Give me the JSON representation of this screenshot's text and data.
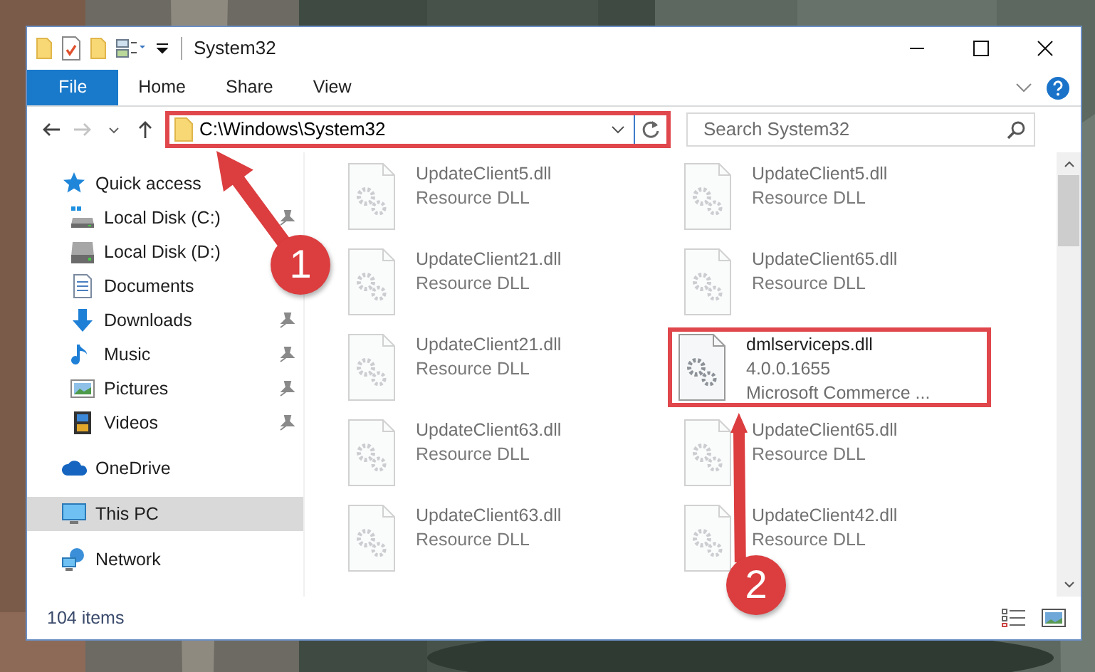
{
  "window": {
    "title": "System32"
  },
  "ribbon_tabs": [
    {
      "label": "File",
      "selected": true
    },
    {
      "label": "Home",
      "selected": false
    },
    {
      "label": "Share",
      "selected": false
    },
    {
      "label": "View",
      "selected": false
    }
  ],
  "address": {
    "value": "C:\\Windows\\System32",
    "highlighted": true
  },
  "search": {
    "placeholder": "Search System32"
  },
  "sidebar": {
    "items": [
      {
        "label": "Quick access",
        "kind": "star",
        "selected": false,
        "children": [
          {
            "label": "Local Disk (C:)",
            "kind": "drive-c",
            "pinned": true
          },
          {
            "label": "Local Disk (D:)",
            "kind": "drive",
            "pinned": false
          },
          {
            "label": "Documents",
            "kind": "documents",
            "pinned": false
          },
          {
            "label": "Downloads",
            "kind": "downloads",
            "pinned": true
          },
          {
            "label": "Music",
            "kind": "music",
            "pinned": true
          },
          {
            "label": "Pictures",
            "kind": "pictures",
            "pinned": true
          },
          {
            "label": "Videos",
            "kind": "videos",
            "pinned": true
          }
        ]
      },
      {
        "label": "OneDrive",
        "kind": "cloud",
        "selected": false
      },
      {
        "label": "This PC",
        "kind": "pc",
        "selected": true
      },
      {
        "label": "Network",
        "kind": "network",
        "selected": false
      }
    ]
  },
  "files": [
    {
      "name": "UpdateClient5.dll",
      "details": [
        "Resource DLL"
      ],
      "highlighted": false
    },
    {
      "name": "UpdateClient5.dll",
      "details": [
        "Resource DLL"
      ],
      "highlighted": false
    },
    {
      "name": "UpdateClient21.dll",
      "details": [
        "Resource DLL"
      ],
      "highlighted": false
    },
    {
      "name": "UpdateClient65.dll",
      "details": [
        "Resource DLL"
      ],
      "highlighted": false
    },
    {
      "name": "UpdateClient21.dll",
      "details": [
        "Resource DLL"
      ],
      "highlighted": false
    },
    {
      "name": "dmlserviceps.dll",
      "details": [
        "4.0.0.1655",
        "Microsoft Commerce ..."
      ],
      "highlighted": true
    },
    {
      "name": "UpdateClient63.dll",
      "details": [
        "Resource DLL"
      ],
      "highlighted": false
    },
    {
      "name": "UpdateClient65.dll",
      "details": [
        "Resource DLL"
      ],
      "highlighted": false
    },
    {
      "name": "UpdateClient63.dll",
      "details": [
        "Resource DLL"
      ],
      "highlighted": false
    },
    {
      "name": "UpdateClient42.dll",
      "details": [
        "Resource DLL"
      ],
      "highlighted": false
    }
  ],
  "status_bar": {
    "count": "104 items"
  },
  "callouts": [
    {
      "number": "1"
    },
    {
      "number": "2"
    }
  ]
}
